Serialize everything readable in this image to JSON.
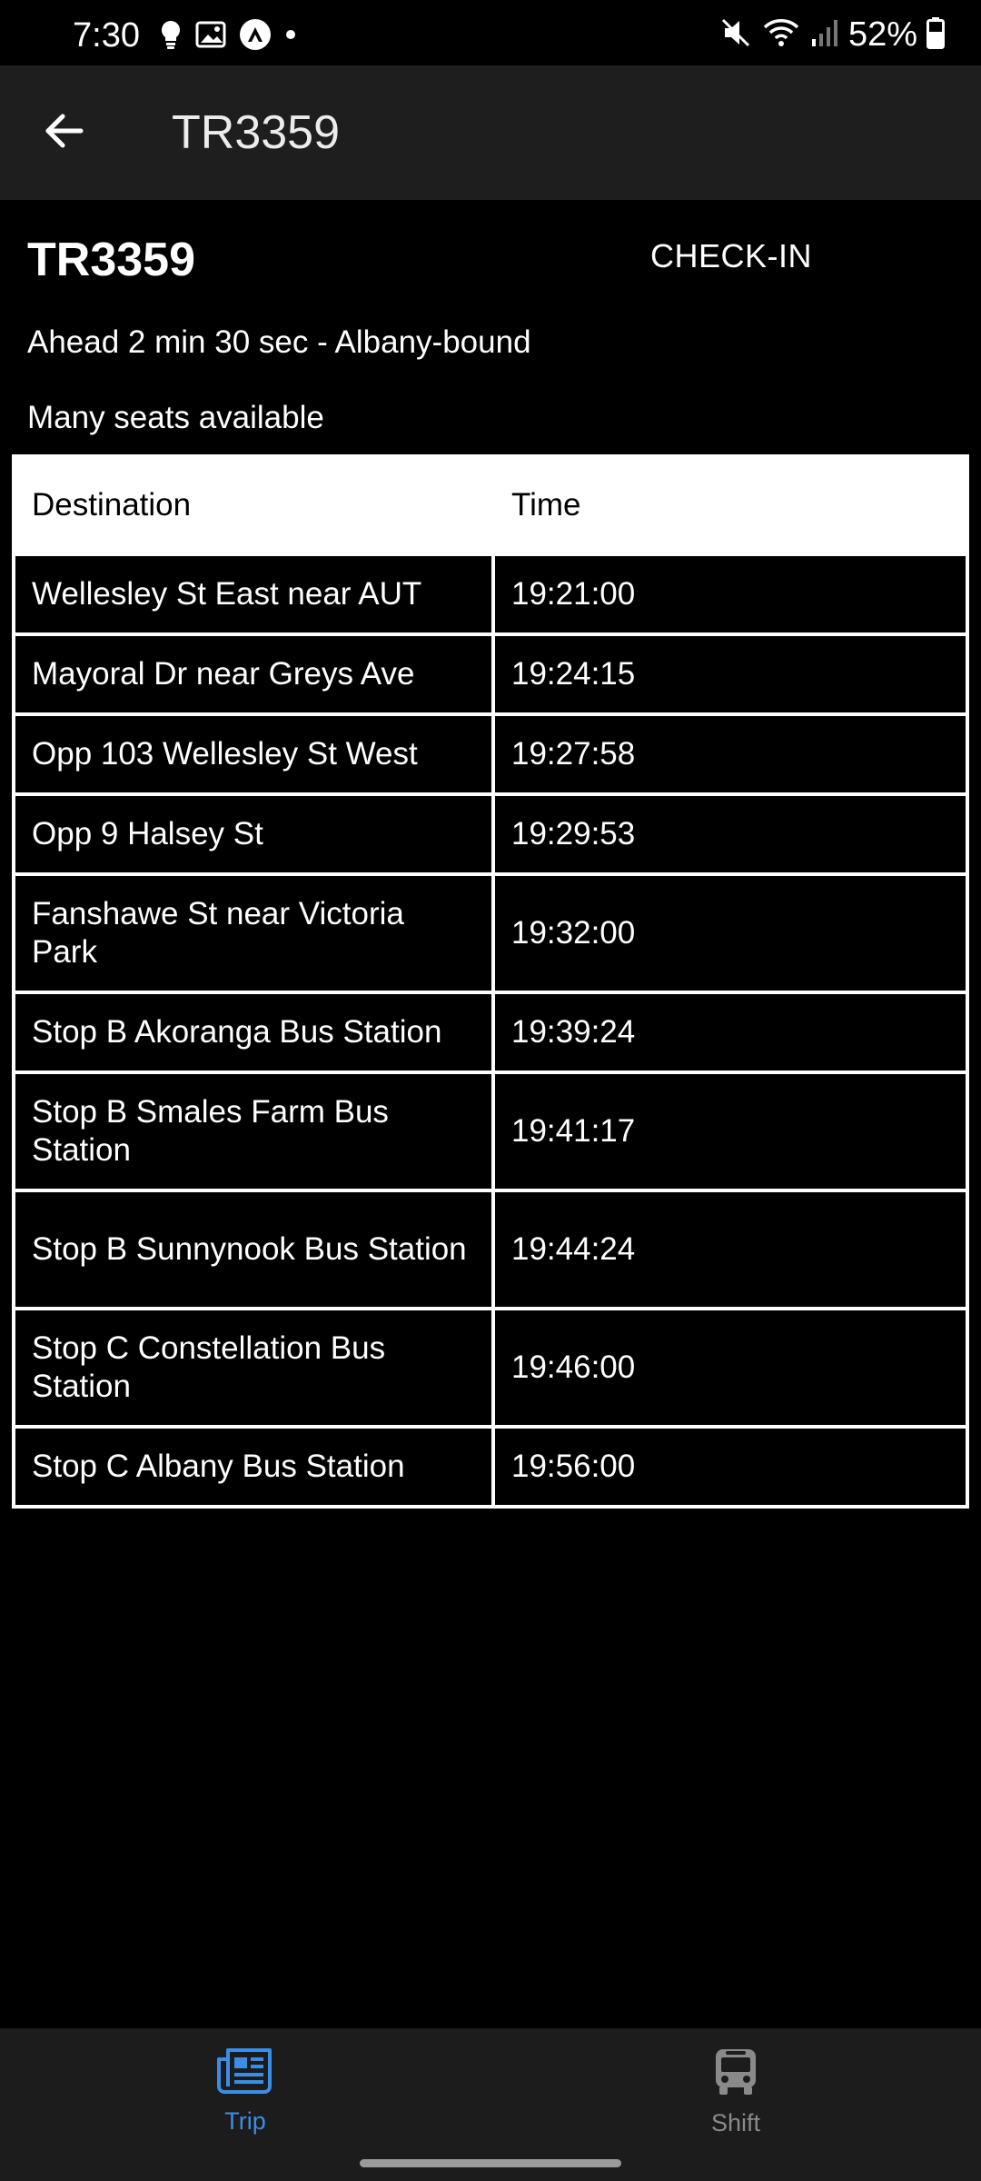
{
  "status_bar": {
    "time": "7:30",
    "left_icons": [
      "lightbulb-icon",
      "image-icon",
      "app-notification-icon",
      "dot-icon"
    ],
    "right_icons": [
      "mute-icon",
      "wifi-icon",
      "signal-icon",
      "battery-icon"
    ],
    "battery": "52%"
  },
  "app_bar": {
    "title": "TR3359"
  },
  "trip": {
    "id": "TR3359",
    "checkin_label": "CHECK-IN",
    "status": "Ahead 2 min 30 sec - Albany-bound",
    "occupancy": "Many seats available"
  },
  "table": {
    "headers": [
      "Destination",
      "Time"
    ],
    "rows": [
      {
        "destination": "Wellesley St East near AUT",
        "time": "19:21:00"
      },
      {
        "destination": "Mayoral Dr near Greys Ave",
        "time": "19:24:15"
      },
      {
        "destination": "Opp 103 Wellesley St West",
        "time": "19:27:58"
      },
      {
        "destination": "Opp 9 Halsey St",
        "time": "19:29:53"
      },
      {
        "destination": "Fanshawe St near Victoria Park",
        "time": "19:32:00"
      },
      {
        "destination": "Stop B Akoranga Bus Station",
        "time": "19:39:24"
      },
      {
        "destination": "Stop B Smales Farm Bus Station",
        "time": "19:41:17"
      },
      {
        "destination": "Stop B Sunnynook Bus Station",
        "time": "19:44:24"
      },
      {
        "destination": "Stop C Constellation Bus Station",
        "time": "19:46:00"
      },
      {
        "destination": "Stop C Albany Bus Station",
        "time": "19:56:00"
      }
    ]
  },
  "bottom_nav": {
    "items": [
      {
        "label": "Trip",
        "icon": "newspaper-icon",
        "active": true
      },
      {
        "label": "Shift",
        "icon": "bus-icon",
        "active": false
      }
    ]
  },
  "colors": {
    "background": "#000000",
    "app_bar": "#1e1e1e",
    "accent": "#3a8ee6",
    "inactive": "#8a8a8a"
  }
}
